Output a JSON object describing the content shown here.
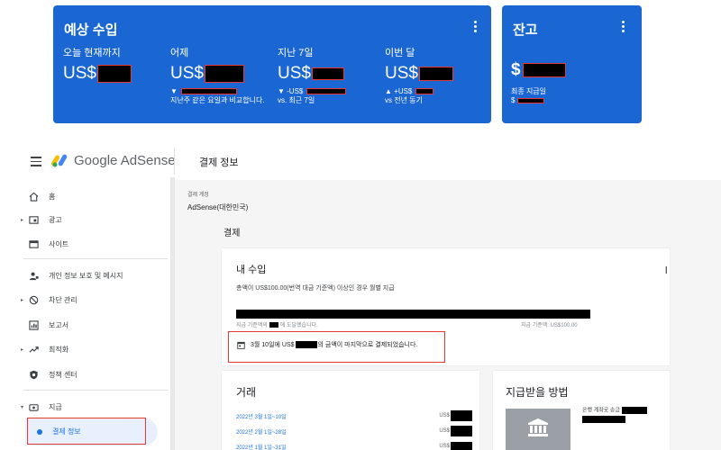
{
  "estimated_earnings": {
    "title": "예상 수입",
    "metrics": [
      {
        "label": "오늘 현재까지",
        "currency": "US$",
        "sub": ""
      },
      {
        "label": "어제",
        "currency": "US$",
        "sub": "▼",
        "sub2": "지난주 같은 요일과 비교합니다."
      },
      {
        "label": "지난 7일",
        "currency": "US$",
        "sub": "▼ -US$",
        "sub2": "vs. 최근 7일"
      },
      {
        "label": "이번 달",
        "currency": "US$",
        "sub": "▲ +US$",
        "sub2": "vs 전년 동기"
      }
    ]
  },
  "balance": {
    "title": "잔고",
    "currency": "$",
    "sub": "최종 지급일",
    "sub2": "$"
  },
  "header": {
    "brand": "Google AdSense",
    "page_title": "결제 정보"
  },
  "sidebar": {
    "items": [
      {
        "label": "홈"
      },
      {
        "label": "광고"
      },
      {
        "label": "사이트"
      },
      {
        "label": "개인 정보 보호 및 메시지"
      },
      {
        "label": "차단 관리"
      },
      {
        "label": "보고서"
      },
      {
        "label": "최적화"
      },
      {
        "label": "정책 센터"
      },
      {
        "label": "지급"
      }
    ],
    "active": "결제 정보"
  },
  "account": {
    "label": "결제 계정",
    "name": "AdSense(대한민국)"
  },
  "section_title": "결제",
  "income": {
    "title": "내 수입",
    "desc": "총액이 US$100.00(번역 대금 기준액) 이상인 경우 월별 지급",
    "progress_left": "지급 기준액의",
    "progress_left2": "에 도달했습니다.",
    "progress_right": "지급 기준액: US$100.00",
    "notice_pre": "3월 10일에 US$",
    "notice_post": "의 금액이 마지막으로 결제되었습니다.",
    "edge_mark": "l"
  },
  "transactions": {
    "title": "거래",
    "rows": [
      {
        "date": "2022년 3월 1일~10일",
        "amount": "US$"
      },
      {
        "date": "2022년 2월 1일~28일",
        "amount": "US$"
      },
      {
        "date": "2022년 1월 1일~31일",
        "amount": "US$"
      }
    ]
  },
  "payment_method": {
    "title": "지급받을 방법",
    "bank_label": "은행 계좌로 송금",
    "bank_icon": "bank-icon"
  },
  "colors": {
    "card_blue": "#1a66d2",
    "accent": "#1a73e8",
    "redaction_border": "#e53935"
  }
}
